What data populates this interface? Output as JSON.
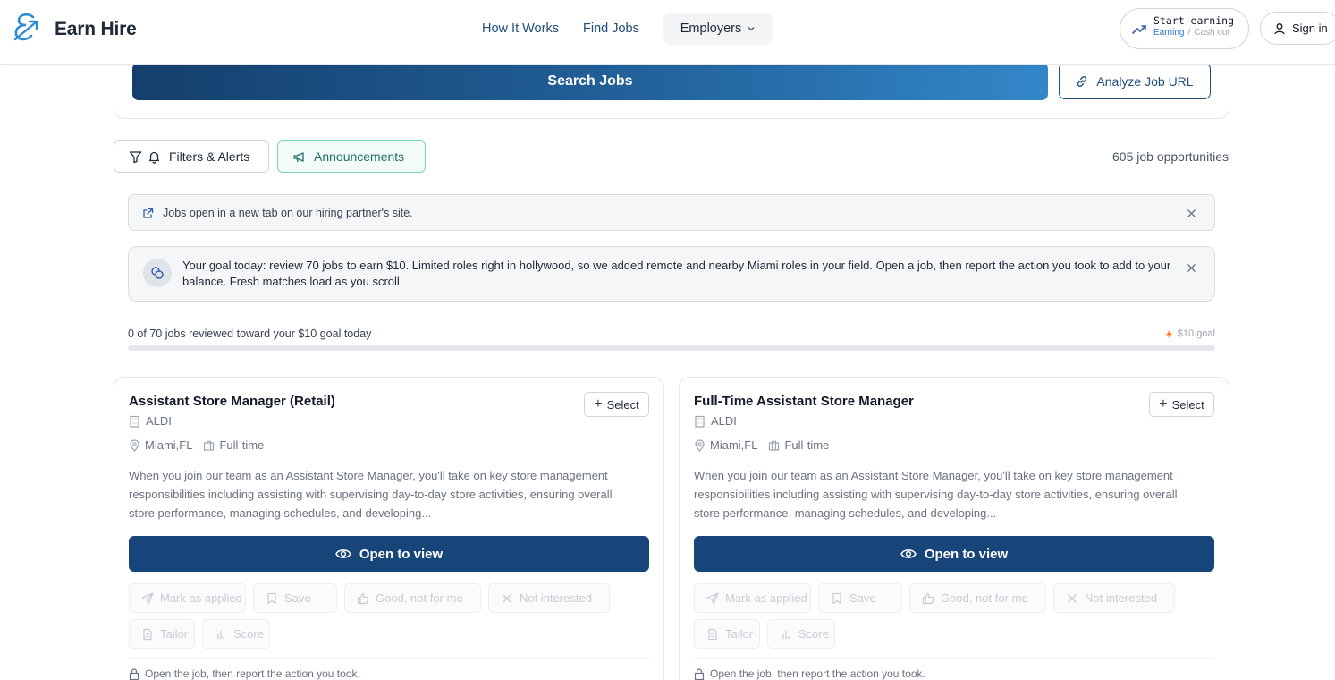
{
  "header": {
    "brand": "Earn Hire",
    "nav": {
      "how": "How It Works",
      "find": "Find Jobs",
      "employers": "Employers"
    },
    "earn": {
      "title": "Start earning",
      "active": "Earning",
      "sep": "/",
      "cashout": "Cash out"
    },
    "signin": "Sign in"
  },
  "search": {
    "button": "Search Jobs",
    "analyze": "Analyze Job URL"
  },
  "toolbar": {
    "filters": "Filters & Alerts",
    "announcements": "Announcements",
    "count": "605 job opportunities"
  },
  "banners": {
    "partner": "Jobs open in a new tab on our hiring partner's site.",
    "goal": "Your goal today: review 70 jobs to earn $10. Limited roles right in hollywood, so we added remote and nearby Miami roles in your field. Open a job, then report the action you took to add to your balance. Fresh matches load as you scroll."
  },
  "progress": {
    "label": "0 of 70 jobs reviewed toward your $10 goal today",
    "goal": "$10 goal",
    "reviewed": 0,
    "target": 70
  },
  "jobs": [
    {
      "title": "Assistant Store Manager (Retail)",
      "company": "ALDI",
      "location": "Miami,FL",
      "type": "Full-time",
      "description": "When you join our team as an Assistant Store Manager, you'll take on key store management responsibilities including assisting with supervising day-to-day store activities, ensuring overall store performance, managing schedules, and developing...",
      "select": "Select",
      "open": "Open to view",
      "actions": {
        "applied": "Mark as applied",
        "save": "Save",
        "good": "Good, not for me",
        "not": "Not interested",
        "tailor": "Tailor",
        "score": "Score"
      },
      "footer": "Open the job, then report the action you took."
    },
    {
      "title": "Full-Time Assistant Store Manager",
      "company": "ALDI",
      "location": "Miami,FL",
      "type": "Full-time",
      "description": "When you join our team as an Assistant Store Manager, you'll take on key store management responsibilities including assisting with supervising day-to-day store activities, ensuring overall store performance, managing schedules, and developing...",
      "select": "Select",
      "open": "Open to view",
      "actions": {
        "applied": "Mark as applied",
        "save": "Save",
        "good": "Good, not for me",
        "not": "Not interested",
        "tailor": "Tailor",
        "score": "Score"
      },
      "footer": "Open the job, then report the action you took."
    }
  ],
  "colors": {
    "primary": "#17457a",
    "accent": "#2f7bd8",
    "teal": "#1f6f67",
    "bolt": "#f97316"
  },
  "icons": [
    "logo-icon",
    "chevron-down-icon",
    "trending-up-icon",
    "user-icon",
    "link-icon",
    "filter-icon",
    "bell-icon",
    "megaphone-icon",
    "external-link-icon",
    "coins-icon",
    "close-icon",
    "bolt-icon",
    "building-icon",
    "map-pin-icon",
    "briefcase-icon",
    "eye-icon",
    "send-icon",
    "bookmark-icon",
    "thumbs-up-icon",
    "x-icon",
    "file-icon",
    "bar-chart-icon",
    "lock-icon"
  ]
}
